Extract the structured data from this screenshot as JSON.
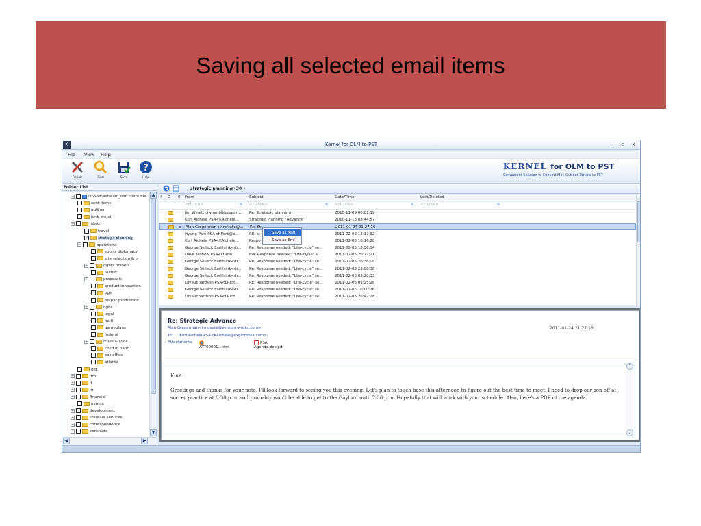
{
  "slide": {
    "title": "Saving all selected email items"
  },
  "window": {
    "title": "Kernel for OLM to PST",
    "icon": "K",
    "controls": "_ ▫ x"
  },
  "menu": [
    "File",
    "View",
    "Help"
  ],
  "toolbar": {
    "repair_label": "Repair",
    "find_label": "Find",
    "save_label": "Save",
    "help_label": "Help"
  },
  "brand": {
    "name_head": "KERNEL",
    "name_tail": "for OLM to PST",
    "tagline": "Competent Solution to Convert Mac Outlook Emails to PST"
  },
  "folder_list": {
    "header": "Folder List",
    "items": [
      {
        "label": "D:\\Soft\\ashwani_olm client file",
        "expander": "⊟",
        "checked": false,
        "root": true
      },
      {
        "label": "sent items",
        "checked": false
      },
      {
        "label": "outbox",
        "checked": false
      },
      {
        "label": "junk e-mail",
        "checked": false
      },
      {
        "label": "inbox",
        "expander": "⊟",
        "checked": false
      },
      {
        "label": "travel",
        "checked": false
      },
      {
        "label": "strategic planning",
        "checked": true,
        "selected": true
      },
      {
        "label": "operations",
        "expander": "⊟",
        "checked": false
      },
      {
        "label": "sports diplomacy",
        "checked": false
      },
      {
        "label": "site selection & tr",
        "checked": false
      },
      {
        "label": "rights holders",
        "expander": "⊞",
        "checked": false
      },
      {
        "label": "reston",
        "checked": false
      },
      {
        "label": "proposals",
        "expander": "⊞",
        "checked": false
      },
      {
        "label": "product innovation",
        "checked": false
      },
      {
        "label": "pgs",
        "checked": false
      },
      {
        "label": "on par production",
        "checked": false
      },
      {
        "label": "ngbs",
        "expander": "⊞",
        "checked": false
      },
      {
        "label": "legal",
        "checked": false
      },
      {
        "label": "haiti",
        "checked": false
      },
      {
        "label": "gameplans",
        "checked": false
      },
      {
        "label": "federal",
        "checked": false
      },
      {
        "label": "cities & cvbs",
        "expander": "⊞",
        "checked": false
      },
      {
        "label": "child in hand",
        "checked": false
      },
      {
        "label": "cos office",
        "checked": false
      },
      {
        "label": "atlanta",
        "checked": false
      },
      {
        "label": "oig",
        "checked": false
      },
      {
        "label": "ltm",
        "expander": "⊞",
        "checked": false
      },
      {
        "label": "it",
        "expander": "⊞",
        "checked": false
      },
      {
        "label": "hr",
        "expander": "⊞",
        "checked": false
      },
      {
        "label": "financial",
        "expander": "⊞",
        "checked": false
      },
      {
        "label": "events",
        "checked": false
      },
      {
        "label": "development",
        "expander": "⊞",
        "checked": false
      },
      {
        "label": "creative services",
        "expander": "⊞",
        "checked": false
      },
      {
        "label": "correspondence",
        "expander": "⊞",
        "checked": false
      },
      {
        "label": "contracts",
        "expander": "⊞",
        "checked": false
      }
    ]
  },
  "email_list": {
    "title": "strategic planning (30 )",
    "columns": {
      "flag": "!",
      "type": "D",
      "attach": "0",
      "from": "From",
      "subject": "Subject",
      "date": "Date/Time",
      "lost": "Lost/Deleted"
    },
    "filter_placeholder": "<FILTER>",
    "rows": [
      {
        "from": "Jim Winett<jwinett@iccspart...",
        "subject": "Re: Strategic planning",
        "date": "2010-11-09 00:01:19",
        "attach": false
      },
      {
        "from": "Kurt Aichele PSA<KAichele...",
        "subject": "Strategic Planning \"Advance\"",
        "date": "2010-11-18 08:44:57",
        "attach": false
      },
      {
        "from": "Alan Gregerman<innovate@...",
        "subject": "Re: St",
        "date": "2011-01-24 21:27:16",
        "attach": true,
        "selected": true
      },
      {
        "from": "Hyung Park PSA<HPark@e...",
        "subject": "RE: st                    -up: folks ...",
        "date": "2011-02-02 12:17:32",
        "attach": false
      },
      {
        "from": "Kurt Aichele PSA<KAichele...",
        "subject": "Respo                   le\" session",
        "date": "2011-02-05 10:16:28",
        "attach": false
      },
      {
        "from": "George Selleck Earthlink<dr...",
        "subject": "Re: Response needed: \"Life-cycle\" se...",
        "date": "2011-02-05 18:56:34",
        "attach": false
      },
      {
        "from": "Dave Tesnow PSA<DTesn...",
        "subject": "FW: Response needed: \"Life-cycle\" s...",
        "date": "2011-02-05 20:27:21",
        "attach": false
      },
      {
        "from": "George Selleck Earthlink<dr...",
        "subject": "Re: Response needed: \"Life-cycle\" se...",
        "date": "2011-02-05 20:36:08",
        "attach": false
      },
      {
        "from": "George Selleck Earthlink<dr...",
        "subject": "Re: Response needed: \"Life-cycle\" se...",
        "date": "2011-02-05 23:08:38",
        "attach": false
      },
      {
        "from": "George Selleck Earthlink<dr...",
        "subject": "Re: Response needed: \"Life-cycle\" se...",
        "date": "2011-02-05 03:28:33",
        "attach": false
      },
      {
        "from": "Lily Richardson PSA<LRich...",
        "subject": "RE: Response needed: \"Life-cycle\" se...",
        "date": "2011-02-05 05:25:28",
        "attach": false
      },
      {
        "from": "George Selleck Earthlink<dr...",
        "subject": "Re: Response needed: \"Life-cycle\" se...",
        "date": "2011-02-06 10:00:26",
        "attach": false
      },
      {
        "from": "Lily Richardson PSA<LRich...",
        "subject": "Re: Response needed: \"Life-cycle\" se...",
        "date": "2011-02-06 20:42:28",
        "attach": false
      }
    ]
  },
  "context_menu": {
    "items": [
      "Save as Msg",
      "Save as Eml"
    ]
  },
  "preview": {
    "subject": "Re: Strategic Advance",
    "from": "Alan Gregerman<innovate@venture-works.com>",
    "date": "2011-01-24 21:27:16",
    "to_label": "To:",
    "to": "Kurt Aichele PSA<KAichele@explorepsa.com>;",
    "attachments_label": "Attachments:",
    "attachments": [
      "ATT00001...htm",
      "PSA Agenda.doc.pdf"
    ],
    "greeting": "Kurt:",
    "body": "Greetings and thanks for your note.  I'll look forward to seeing you this evening.  Let's plan to touch base this afternoon to figure out the best time to meet.  I need to drop our son off at soccer practice at 6:30 p.m. so I probably won't be able to get to the Gaylord until 7:30 p.m.  Hopefully that will work with your schedule.  Also, here's a PDF of the agenda."
  },
  "colors": {
    "banner": "#c0504d",
    "selection": "#c5d9f3",
    "menu_highlight": "#2f6fcd",
    "folder_icon": "#f3c84a"
  }
}
